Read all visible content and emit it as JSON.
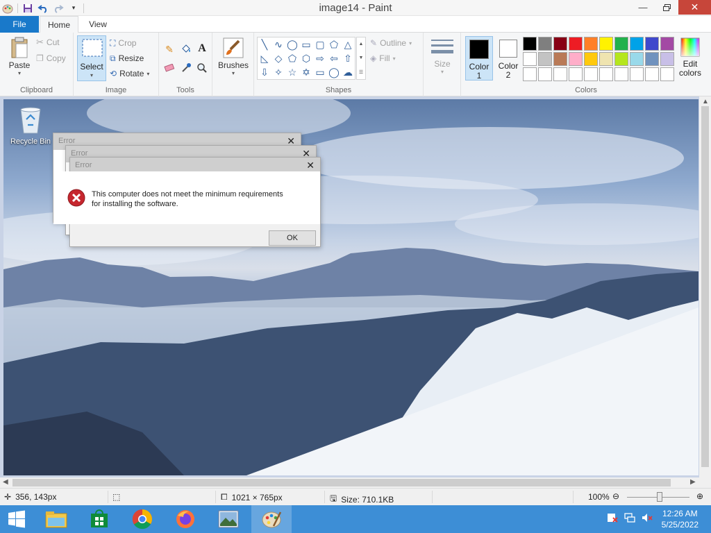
{
  "window": {
    "title": "image14 - Paint"
  },
  "qat": {
    "icons": [
      "paint-app-icon",
      "save-icon",
      "undo-icon",
      "redo-icon",
      "customize-icon"
    ]
  },
  "tabs": {
    "file": "File",
    "home": "Home",
    "view": "View"
  },
  "ribbon": {
    "clipboard": {
      "label": "Clipboard",
      "paste": "Paste",
      "cut": "Cut",
      "copy": "Copy"
    },
    "image": {
      "label": "Image",
      "select": "Select",
      "crop": "Crop",
      "resize": "Resize",
      "rotate": "Rotate"
    },
    "tools": {
      "label": "Tools"
    },
    "brushes": {
      "label": "Brushes"
    },
    "shapes": {
      "label": "Shapes",
      "outline": "Outline",
      "fill": "Fill"
    },
    "size": {
      "label": "Size"
    },
    "colors": {
      "label": "Colors",
      "color1": "Color",
      "color1_num": "1",
      "color2": "Color",
      "color2_num": "2",
      "edit": "Edit",
      "edit2": "colors",
      "color1_value": "#000000",
      "color2_value": "#ffffff",
      "palette": [
        "#000000",
        "#7f7f7f",
        "#880015",
        "#ed1c24",
        "#ff7f27",
        "#fff200",
        "#22b14c",
        "#00a2e8",
        "#3f48cc",
        "#a349a4",
        "#ffffff",
        "#c3c3c3",
        "#b97a57",
        "#ffaec9",
        "#ffc90e",
        "#efe4b0",
        "#b5e61d",
        "#99d9ea",
        "#7092be",
        "#c8bfe7",
        "#ffffff",
        "#ffffff",
        "#ffffff",
        "#ffffff",
        "#ffffff",
        "#ffffff",
        "#ffffff",
        "#ffffff",
        "#ffffff",
        "#ffffff"
      ]
    }
  },
  "desktop": {
    "recycle_bin": "Recycle Bin"
  },
  "dialogs": {
    "title": "Error",
    "message": "This computer does not meet the minimum requirements for installing the software.",
    "ok": "OK"
  },
  "status": {
    "cursor_pos": "356, 143px",
    "image_dims": "1021 × 765px",
    "file_size": "Size: 710.1KB",
    "zoom": "100%"
  },
  "taskbar": {
    "apps": [
      "start-icon",
      "file-explorer-icon",
      "store-icon",
      "chrome-icon",
      "firefox-icon",
      "photos-icon",
      "paint-icon"
    ],
    "time": "12:26 AM",
    "date": "5/25/2022"
  }
}
